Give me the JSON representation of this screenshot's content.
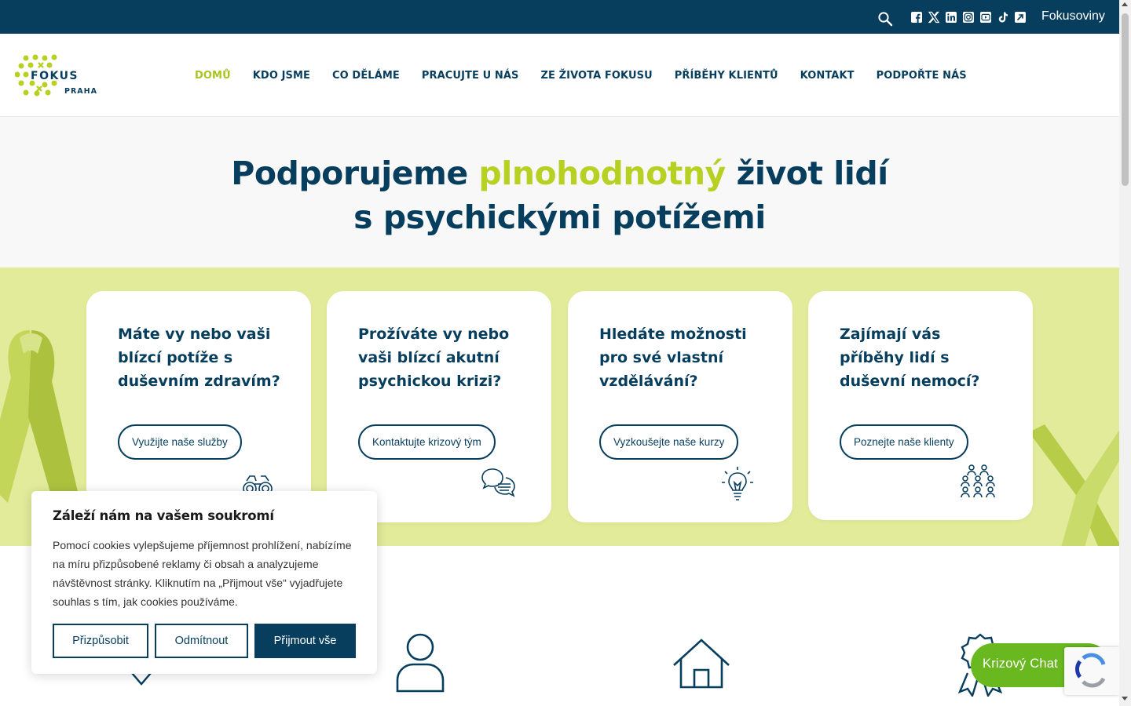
{
  "topbar": {
    "search_icon": "search-icon",
    "socials": [
      "facebook-icon",
      "x-icon",
      "linkedin-icon",
      "instagram-icon",
      "youtube-icon",
      "tiktok-icon",
      "external-link-icon"
    ],
    "link_label": "Fokusoviny"
  },
  "logo": {
    "word": "FOKUS",
    "city": "PRAHA"
  },
  "nav": {
    "items": [
      {
        "label": "DOMŮ"
      },
      {
        "label": "KDO JSME"
      },
      {
        "label": "CO DĚLÁME"
      },
      {
        "label": "PRACUJTE U NÁS"
      },
      {
        "label": "ZE ŽIVOTA FOKUSU"
      },
      {
        "label": "PŘÍBĚHY KLIENTŮ"
      },
      {
        "label": "KONTAKT"
      },
      {
        "label": "PODPOŘTE NÁS"
      }
    ]
  },
  "hero": {
    "line1_start": "Podporujeme ",
    "line1_accent": "plnohodnotný",
    "line1_end": " život lidí",
    "line2": "s psychickými potížemi"
  },
  "cards": [
    {
      "title": "Máte vy nebo vaši blízcí potíže s duševním zdravím?",
      "button": "Využijte naše služby",
      "icon": "binoculars-icon"
    },
    {
      "title": "Prožíváte vy nebo vaši blízcí akutní psychickou krizi?",
      "button": "Kontaktujte krizový tým",
      "icon": "chat-bubbles-icon"
    },
    {
      "title": "Hledáte možnosti pro své vlastní vzdělávání?",
      "button": "Vyzkoušejte naše kurzy",
      "icon": "lightbulb-icon"
    },
    {
      "title": "Zajímají vás příběhy lidí s duševní nemocí?",
      "button": "Poznejte naše klienty",
      "icon": "people-group-icon"
    }
  ],
  "cookie": {
    "title": "Záleží nám na vašem soukromí",
    "text": "Pomocí cookies vylepšujeme příjemnost prohlížení, nabízíme na míru přizpůsobené reklamy či obsah a analyzujeme návštěvnost stránky. Kliknutím na „Přijmout vše“ vyjadřujete souhlas s tím, jak cookies používáme.",
    "customize": "Přizpůsobit",
    "reject": "Odmítnout",
    "accept": "Přijmout vše"
  },
  "chat": {
    "label": "Krizový Chat"
  },
  "colors": {
    "brand_dark": "#073e5e",
    "accent_green": "#b8d022",
    "band_green": "#e2eb9a",
    "chat_green": "#6ab820"
  }
}
